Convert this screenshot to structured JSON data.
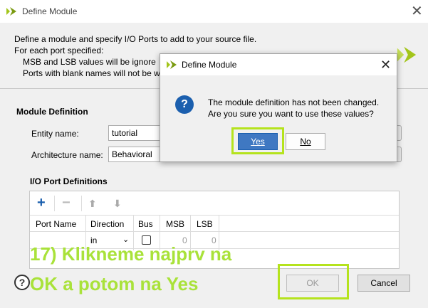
{
  "window": {
    "title": "Define Module"
  },
  "description": {
    "line1": "Define a module and specify I/O Ports to add to your source file.",
    "line2": "For each port specified:",
    "line3": "MSB and LSB values will be ignore",
    "line4": "Ports with blank names will not be w"
  },
  "module_definition": {
    "heading": "Module Definition",
    "entity_label": "Entity name:",
    "entity_value": "tutorial",
    "architecture_label": "Architecture name:",
    "architecture_value": "Behavioral"
  },
  "io_ports": {
    "heading": "I/O Port Definitions",
    "toolbar": {
      "add": "+",
      "remove": "−",
      "up": "⬆",
      "down": "⬇"
    },
    "columns": [
      "Port Name",
      "Direction",
      "Bus",
      "MSB",
      "LSB"
    ],
    "row": {
      "direction": "in",
      "msb": "0",
      "lsb": "0"
    }
  },
  "footer": {
    "help": "?",
    "ok_label": "OK",
    "cancel_label": "Cancel"
  },
  "annotation": {
    "line1": "17) Klikneme najprv na",
    "line2": "OK a potom na Yes",
    "color": "#a9e23a"
  },
  "confirm_dialog": {
    "title": "Define Module",
    "message_line1": "The module definition has not been changed.",
    "message_line2": "Are you sure you want to use these values?",
    "yes_label": "Yes",
    "no_label": "No",
    "icon": "question-icon"
  },
  "colors": {
    "accent": "#b5e31d",
    "primary_button": "#1b5fae"
  }
}
